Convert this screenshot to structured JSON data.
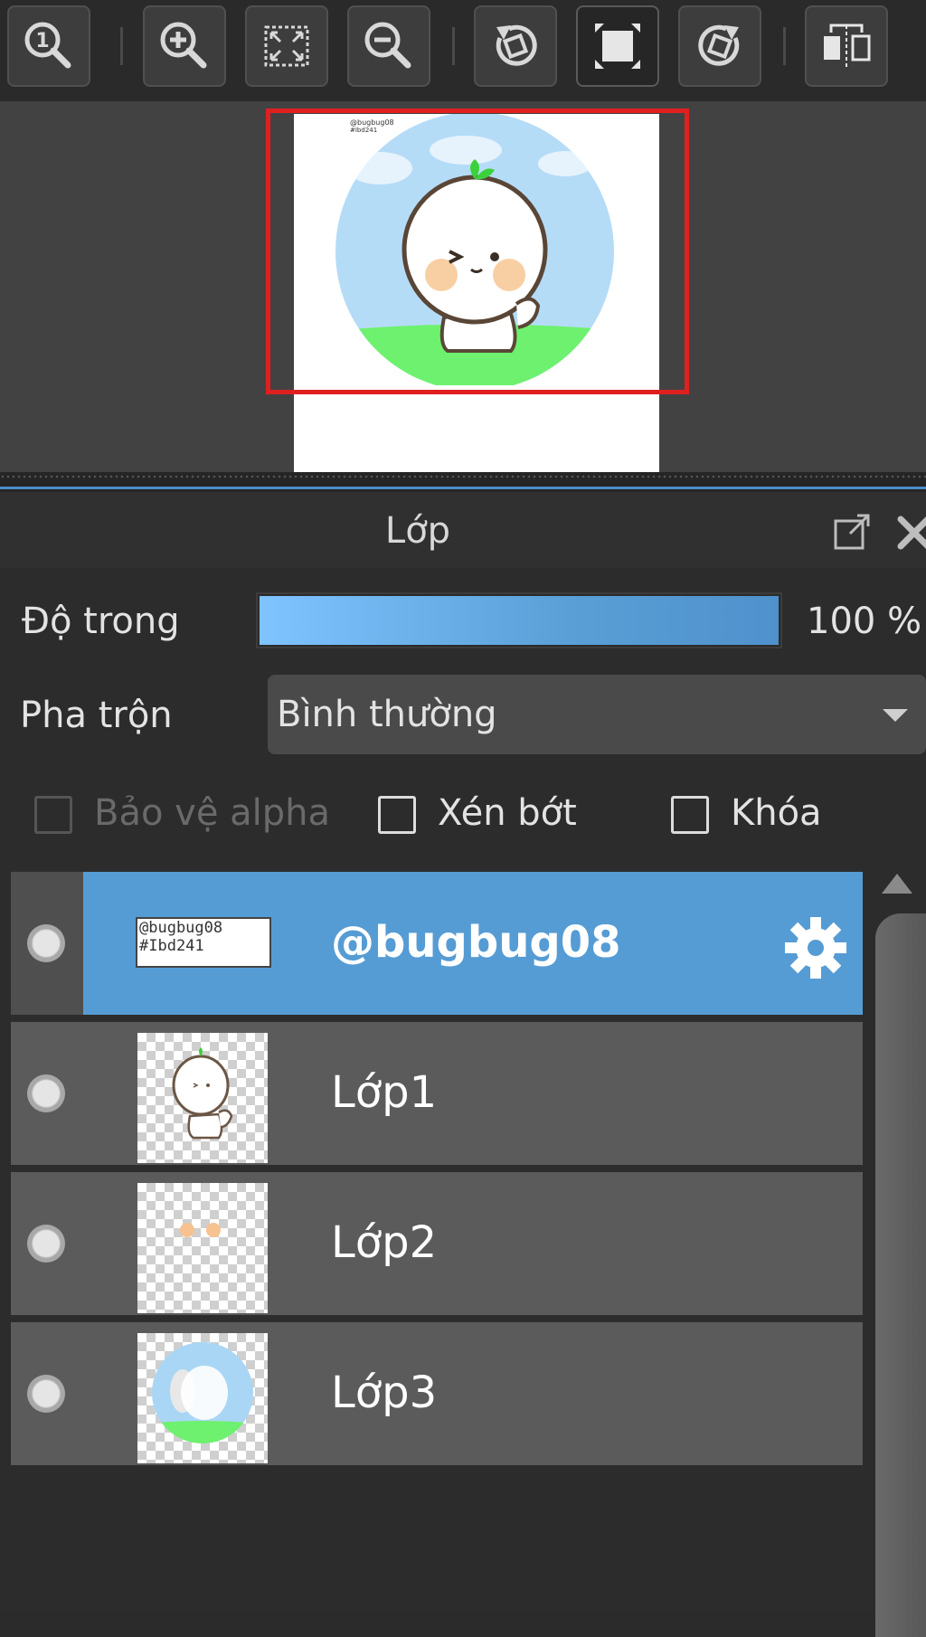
{
  "toolbar": {
    "buttons": [
      {
        "icon": "zoom-actual-size-icon"
      },
      {
        "icon": "zoom-in-icon"
      },
      {
        "icon": "fit-to-screen-icon"
      },
      {
        "icon": "zoom-out-icon"
      },
      {
        "icon": "rotate-left-icon"
      },
      {
        "icon": "reset-rotation-icon",
        "active": true
      },
      {
        "icon": "rotate-right-icon"
      },
      {
        "icon": "flip-horizontal-icon"
      }
    ]
  },
  "navigator": {
    "preview_text": [
      "@bugbug08",
      "#Ibd241"
    ],
    "viewport_color": "#e02020"
  },
  "layer_panel": {
    "title": "Lớp",
    "opacity_label": "Độ trong",
    "opacity_percent": 100,
    "opacity_text": "100 %",
    "blend_label": "Pha trộn",
    "blend_value": "Bình thường",
    "checkboxes": [
      {
        "label": "Bảo vệ alpha",
        "checked": false,
        "enabled": false
      },
      {
        "label": "Xén bớt",
        "checked": false,
        "enabled": true
      },
      {
        "label": "Khóa",
        "checked": false,
        "enabled": true
      }
    ],
    "layers": [
      {
        "name": "@bugbug08",
        "selected": true,
        "thumb_text": [
          "@bugbug08",
          "#Ibd241"
        ]
      },
      {
        "name": "Lớp1",
        "selected": false
      },
      {
        "name": "Lớp2",
        "selected": false
      },
      {
        "name": "Lớp3",
        "selected": false
      }
    ],
    "accent_color": "#569cd4"
  }
}
